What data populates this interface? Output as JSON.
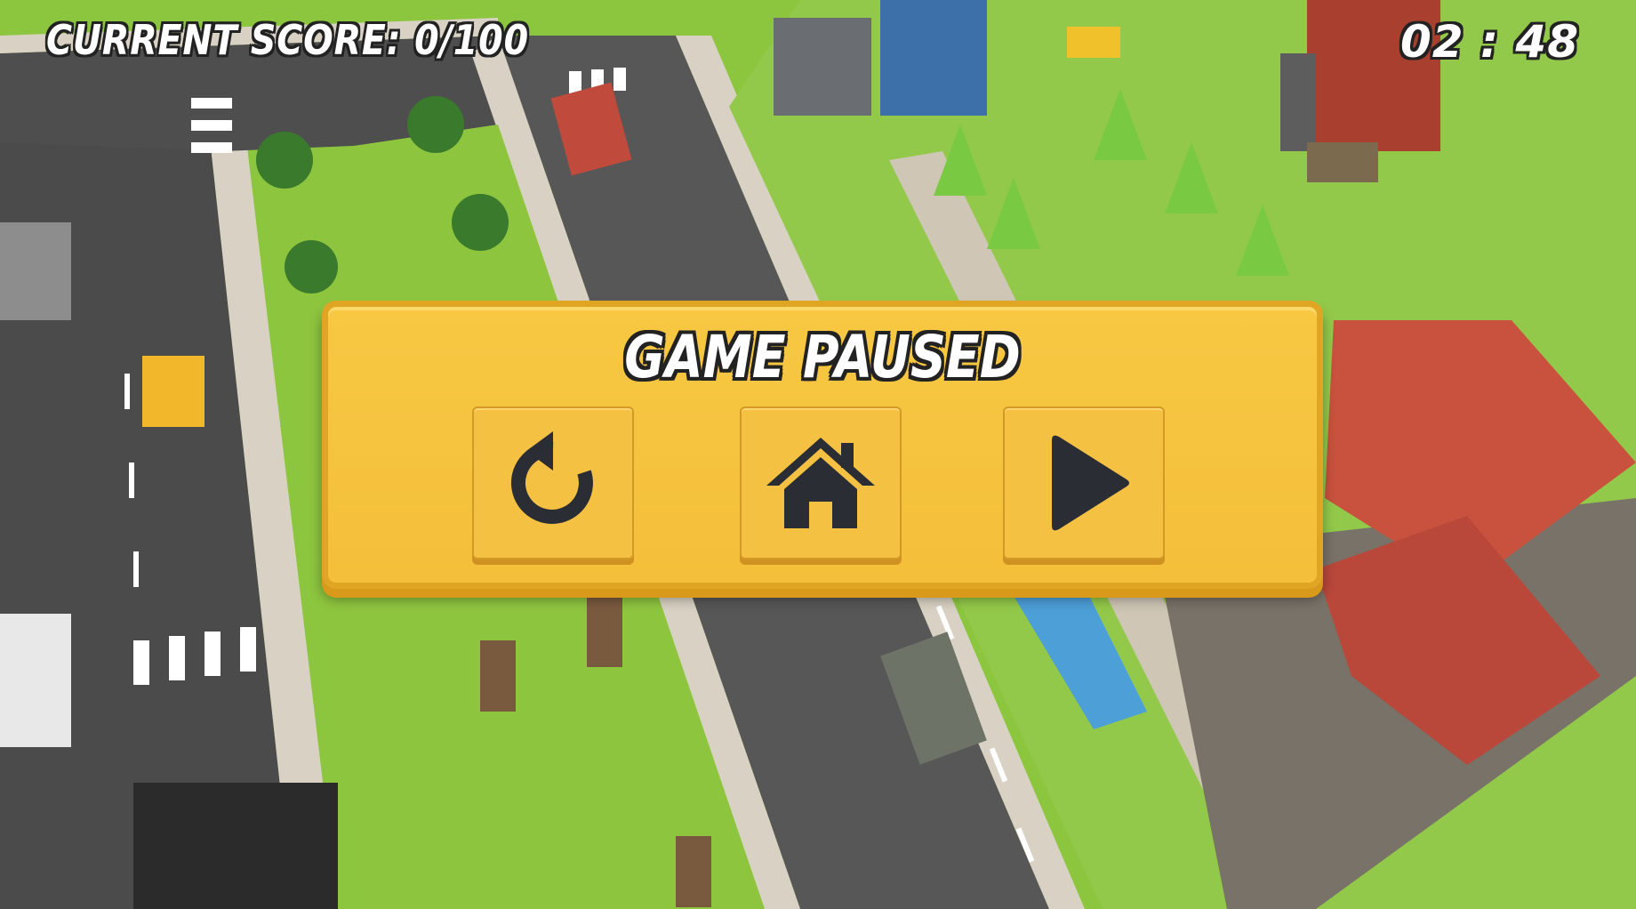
{
  "hud": {
    "score_label": "CURRENT SCORE: 0/100",
    "timer": "02 : 48"
  },
  "pause_menu": {
    "title": "GAME PAUSED",
    "buttons": [
      {
        "action": "restart",
        "icon": "restart-icon"
      },
      {
        "action": "home",
        "icon": "home-icon"
      },
      {
        "action": "resume",
        "icon": "play-icon"
      }
    ]
  },
  "colors": {
    "panel": "#f4bf3a",
    "panel_border": "#e0a523",
    "icon": "#2a2d33",
    "grass": "#8cc63e",
    "road": "#4a4a4a"
  }
}
